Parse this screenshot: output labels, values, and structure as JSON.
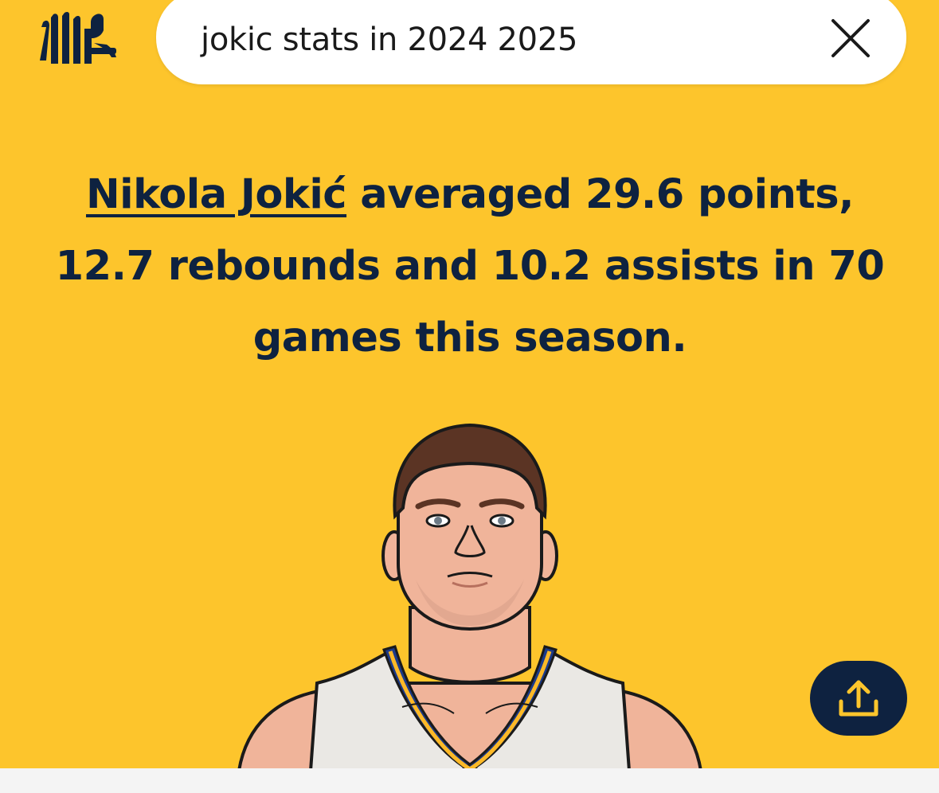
{
  "app": {
    "logo_icon": "statmuse-logo-icon"
  },
  "search": {
    "query": "jokic stats in 2024 2025",
    "clear_icon": "close-icon"
  },
  "answer": {
    "player_name": "Nikola Jokić",
    "sentence_rest": " averaged 29.6 points, 12.7 rebounds and 10.2 assists in 70 games this season."
  },
  "player_image": {
    "icon": "player-illustration",
    "jersey_colors": {
      "jersey": "#eae8e4",
      "trim_blue": "#1b3a8a",
      "trim_gold": "#fdb927"
    }
  },
  "share": {
    "icon": "share-icon"
  },
  "colors": {
    "background": "#fdc52c",
    "text": "#0e2240",
    "share_button": "#0e2240"
  }
}
